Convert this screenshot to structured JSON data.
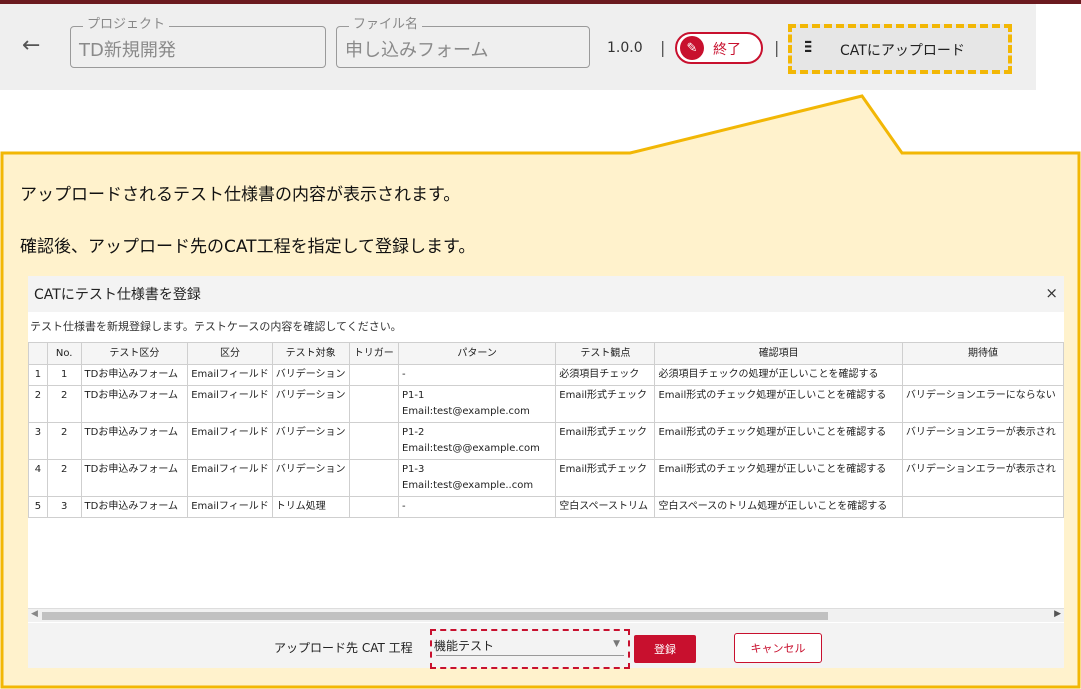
{
  "header": {
    "project_label": "プロジェクト",
    "project_value": "TD新規開発",
    "file_label": "ファイル名",
    "file_value": "申し込みフォーム",
    "version": "1.0.0",
    "separator": "|",
    "end_label": "終了",
    "upload_label": "CATにアップロード"
  },
  "callout": {
    "line1": "アップロードされるテスト仕様書の内容が表示されます。",
    "line2": "確認後、アップロード先のCAT工程を指定して登録します。"
  },
  "dialog": {
    "title": "CATにテスト仕様書を登録",
    "close": "×",
    "description": "テスト仕様書を新規登録します。テストケースの内容を確認してください。",
    "columns": [
      "",
      "No.",
      "テスト区分",
      "区分",
      "テスト対象",
      "トリガー",
      "パターン",
      "テスト観点",
      "確認項目",
      "期待値"
    ],
    "rows": [
      {
        "rn": "1",
        "no": "1",
        "category": "TDお申込みフォーム",
        "division": "Emailフィールド",
        "target": "バリデーション",
        "trigger": "",
        "pattern1": "-",
        "pattern2": "",
        "viewpoint": "必須項目チェック",
        "check": "必須項目チェックの処理が正しいことを確認する",
        "expected": ""
      },
      {
        "rn": "2",
        "no": "2",
        "category": "TDお申込みフォーム",
        "division": "Emailフィールド",
        "target": "バリデーション",
        "trigger": "",
        "pattern1": "P1-1",
        "pattern2": "Email:test@example.com",
        "viewpoint": "Email形式チェック",
        "check": "Email形式のチェック処理が正しいことを確認する",
        "expected": "バリデーションエラーにならない"
      },
      {
        "rn": "3",
        "no": "2",
        "category": "TDお申込みフォーム",
        "division": "Emailフィールド",
        "target": "バリデーション",
        "trigger": "",
        "pattern1": "P1-2",
        "pattern2": "Email:test@@example.com",
        "viewpoint": "Email形式チェック",
        "check": "Email形式のチェック処理が正しいことを確認する",
        "expected": "バリデーションエラーが表示され"
      },
      {
        "rn": "4",
        "no": "2",
        "category": "TDお申込みフォーム",
        "division": "Emailフィールド",
        "target": "バリデーション",
        "trigger": "",
        "pattern1": "P1-3",
        "pattern2": "Email:test@example..com",
        "viewpoint": "Email形式チェック",
        "check": "Email形式のチェック処理が正しいことを確認する",
        "expected": "バリデーションエラーが表示され"
      },
      {
        "rn": "5",
        "no": "3",
        "category": "TDお申込みフォーム",
        "division": "Emailフィールド",
        "target": "トリム処理",
        "trigger": "",
        "pattern1": "-",
        "pattern2": "",
        "viewpoint": "空白スペーストリム",
        "check": "空白スペースのトリム処理が正しいことを確認する",
        "expected": ""
      }
    ],
    "scroll_left": "◀",
    "scroll_right": "▶",
    "dest_label": "アップロード先 CAT 工程",
    "dest_value": "機能テスト",
    "dest_arrow": "▼",
    "register_label": "登録",
    "cancel_label": "キャンセル"
  },
  "colors": {
    "accent_red": "#c8102e",
    "callout_yellow": "#f2b705",
    "callout_fill": "#fff2cc",
    "header_bg": "#efefef"
  },
  "icons": {
    "back": "arrow-left-icon",
    "end": "pencil-icon",
    "upload": "sliders-icon"
  }
}
